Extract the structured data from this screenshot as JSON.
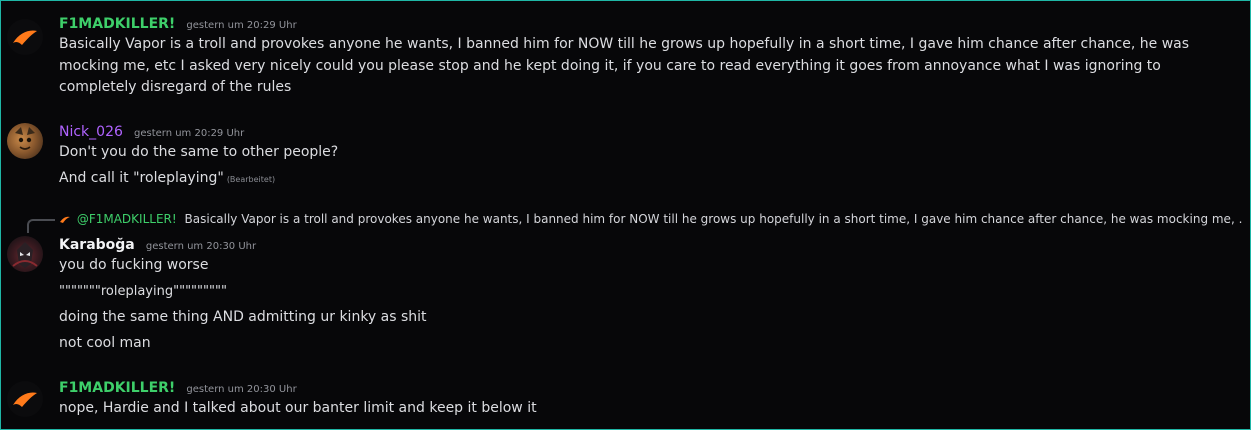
{
  "messages": [
    {
      "author": "F1MADKILLER!",
      "timestamp": "gestern um 20:29 Uhr",
      "author_color": "#3ecf6a",
      "avatar_icon": "mclaren-logo-icon",
      "lines": [
        "Basically Vapor is a troll and provokes anyone he wants, I banned him for NOW till he grows up hopefully in a short time, I gave him chance after chance, he was mocking me, etc I asked very nicely could you please stop and he kept doing it, if you care to read everything it goes from annoyance what I was ignoring to completely disregard of the rules"
      ]
    },
    {
      "author": "Nick_026",
      "timestamp": "gestern um 20:29 Uhr",
      "author_color": "#b063ff",
      "avatar_icon": "cartoon-avatar-icon",
      "lines": [
        "Don't you do the same to other people?",
        "And call it \"roleplaying\""
      ],
      "edited_label": "(Bearbeitet)"
    },
    {
      "author": "Karaboğa",
      "timestamp": "gestern um 20:30 Uhr",
      "author_color": "#f2f3f5",
      "avatar_icon": "dark-knight-avatar-icon",
      "reply": {
        "author": "@F1MADKILLER!",
        "text": "Basically Vapor is a troll and provokes anyone he wants, I banned him for NOW till he grows up hopefully in a short time, I gave him chance after chance, he was mocking me, ..."
      },
      "lines": [
        "you do fucking worse",
        "\"\"\"\"\"\"\"roleplaying\"\"\"\"\"\"\"\"\"",
        "doing the same thing AND admitting ur kinky as shit",
        "not cool man"
      ]
    },
    {
      "author": "F1MADKILLER!",
      "timestamp": "gestern um 20:30 Uhr",
      "author_color": "#3ecf6a",
      "avatar_icon": "mclaren-logo-icon",
      "lines": [
        "nope, Hardie and I talked about our banter limit and keep it below it"
      ]
    }
  ],
  "colors": {
    "background": "#070709",
    "frame_border": "#1fb6a6",
    "mclaren_orange": "#ff7a1a"
  }
}
